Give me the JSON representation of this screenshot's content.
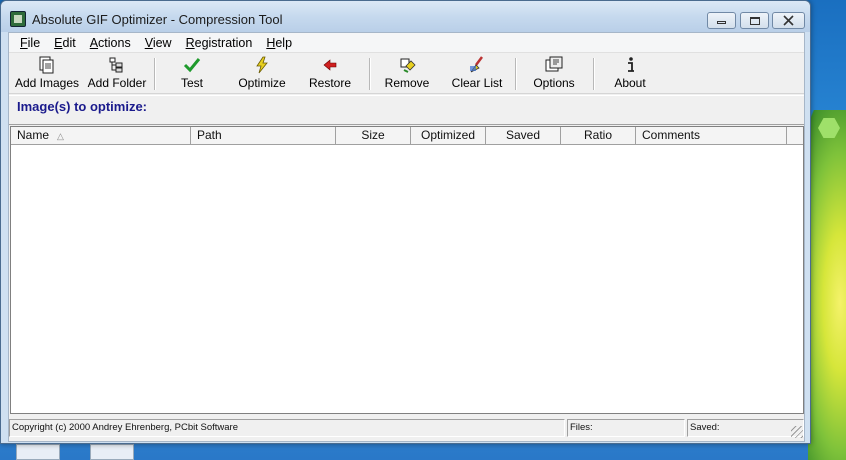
{
  "window": {
    "title": "Absolute GIF Optimizer - Compression Tool"
  },
  "menu": [
    {
      "label": "File",
      "ul": "F",
      "rest": "ile"
    },
    {
      "label": "Edit",
      "ul": "E",
      "rest": "dit"
    },
    {
      "label": "Actions",
      "ul": "A",
      "rest": "ctions"
    },
    {
      "label": "View",
      "ul": "V",
      "rest": "iew"
    },
    {
      "label": "Registration",
      "ul": "R",
      "rest": "egistration"
    },
    {
      "label": "Help",
      "ul": "H",
      "rest": "elp"
    }
  ],
  "toolbar": {
    "add_images": "Add Images",
    "add_folder": "Add Folder",
    "test": "Test",
    "optimize": "Optimize",
    "restore": "Restore",
    "remove": "Remove",
    "clear_list": "Clear List",
    "options": "Options",
    "about": "About"
  },
  "heading": "Image(s) to optimize:",
  "list": {
    "columns": [
      "Name",
      "Path",
      "Size",
      "Optimized",
      "Saved",
      "Ratio",
      "Comments"
    ],
    "rows": []
  },
  "status": {
    "copyright": "Copyright (c) 2000 Andrey Ehrenberg, PCbit Software",
    "files": "Files:",
    "saved": "Saved:"
  },
  "icons": {
    "add_images": "pages-icon",
    "add_folder": "folder-tree-icon",
    "test": "checkmark-icon",
    "optimize": "lightning-icon",
    "restore": "back-arrow-icon",
    "remove": "eraser-icon",
    "clear_list": "brush-icon",
    "options": "options-icon",
    "about": "info-icon"
  },
  "colors": {
    "heading": "#1a1a8c",
    "test_check": "#1e9a2c",
    "optimize_bolt": "#e8d020",
    "restore_arrow": "#d02020"
  }
}
